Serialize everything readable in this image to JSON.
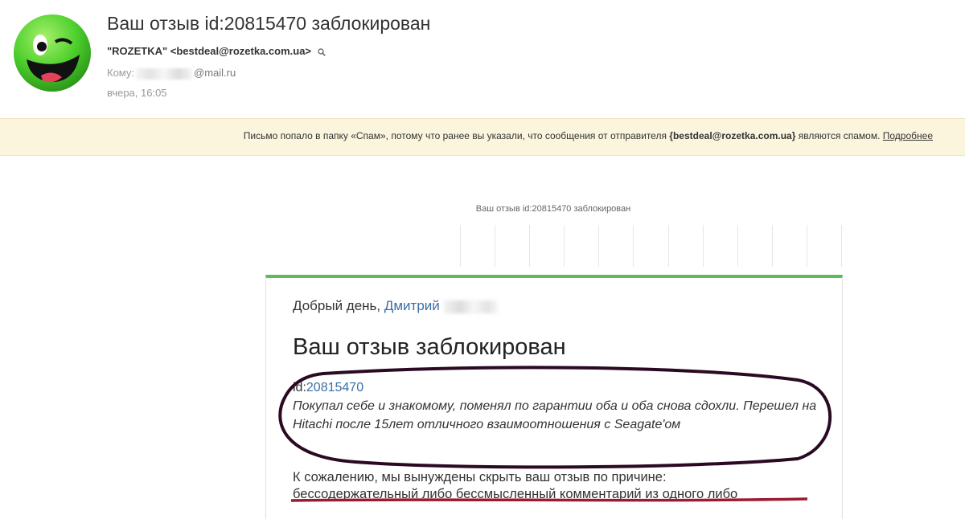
{
  "header": {
    "subject": "Ваш отзыв id:20815470 заблокирован",
    "sender": "\"ROZETKA\" <bestdeal@rozetka.com.ua>",
    "to_label": "Кому:",
    "to_domain": "@mail.ru",
    "date": "вчера, 16:05",
    "avatar_icon": "winking-smiley-icon",
    "search_icon": "magnifier-icon"
  },
  "spam_notice": {
    "text_before": "Письмо попало в папку «Спам», потому что ранее вы указали, что сообщения от отправителя ",
    "sender": "{bestdeal@rozetka.com.ua}",
    "text_after": " являются спамом. ",
    "more_link": "Подробнее"
  },
  "email": {
    "preheader": "Ваш отзыв id:20815470 заблокирован",
    "greeting": "Добрый день, ",
    "name": "Дмитрий",
    "title": "Ваш отзыв заблокирован",
    "id_label": "id:",
    "id_value": "20815470",
    "review_text": "Покупал себе и знакомому, поменял по гарантии оба и оба снова сдохли. Перешел на Hitachi после 15лет отличного взаимоотношения с Seagate'ом",
    "reason_intro": "К сожалению, мы вынуждены скрыть ваш отзыв по причине:",
    "reason": "бессодержательный либо бессмысленный комментарий из одного либо"
  },
  "colors": {
    "spam_bg": "#fbf5dd",
    "card_accent": "#5cbc5a",
    "link": "#3a6ea5",
    "annotation_ellipse": "#2a0a22",
    "annotation_underline": "#9c1a32"
  }
}
